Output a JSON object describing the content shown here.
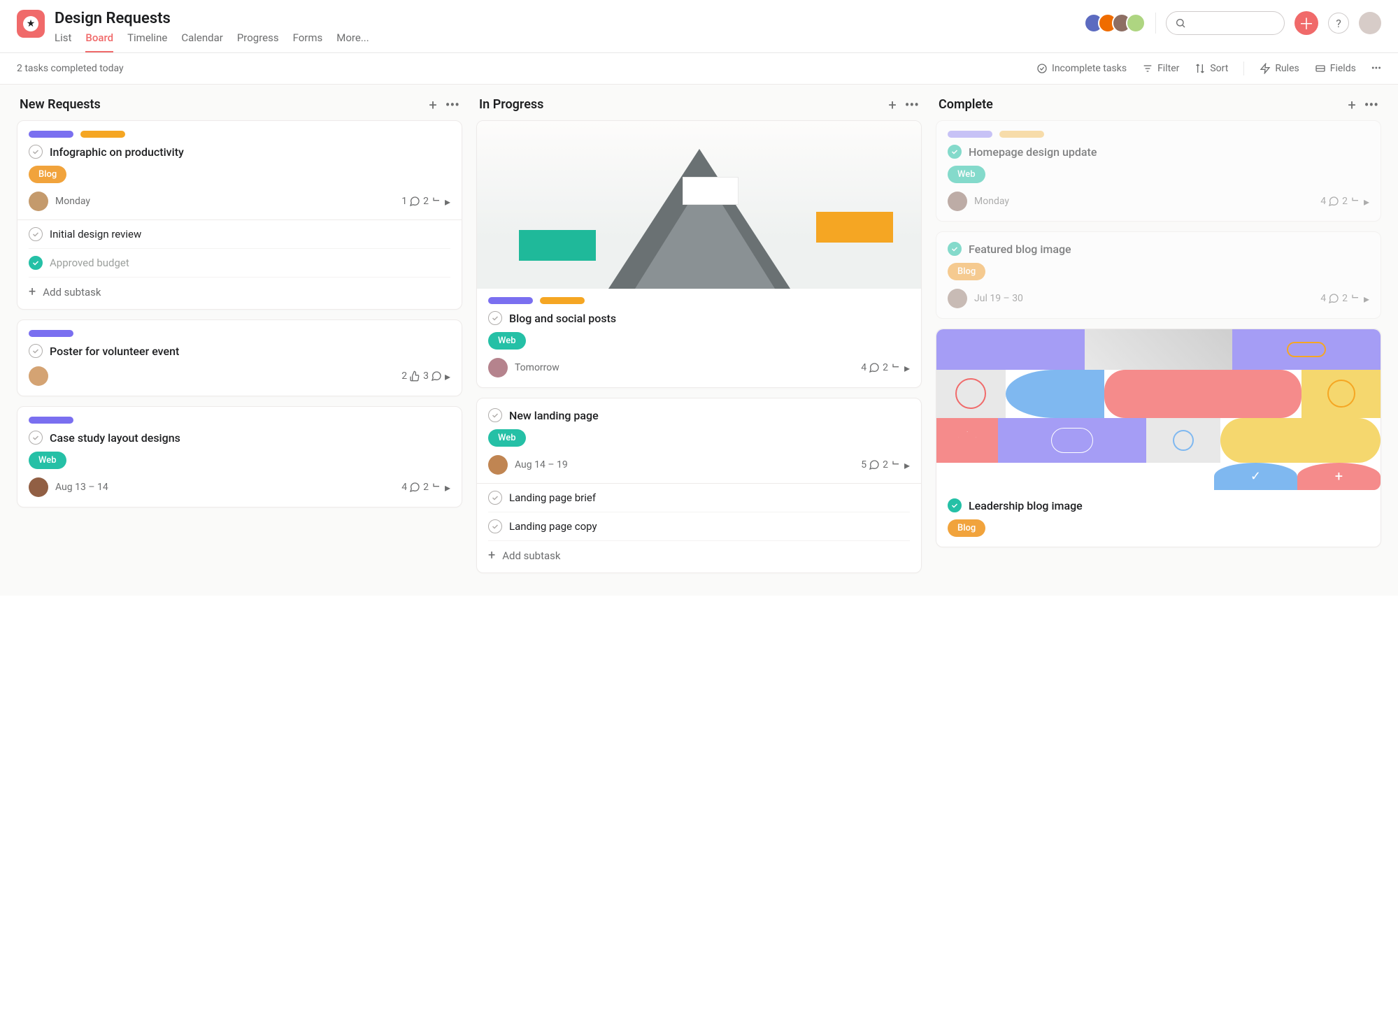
{
  "header": {
    "title": "Design Requests",
    "tabs": [
      "List",
      "Board",
      "Timeline",
      "Calendar",
      "Progress",
      "Forms",
      "More..."
    ],
    "active_tab": "Board",
    "search_placeholder": ""
  },
  "toolbar": {
    "status": "2 tasks completed today",
    "incomplete": "Incomplete tasks",
    "filter": "Filter",
    "sort": "Sort",
    "rules": "Rules",
    "fields": "Fields"
  },
  "columns": [
    {
      "title": "New Requests",
      "cards": [
        {
          "pills": [
            "#7a6ff0",
            "#f5a623"
          ],
          "title": "Infographic on productivity",
          "tag": {
            "label": "Blog",
            "type": "blog"
          },
          "assignee_color": "#c49a6c",
          "due": "Monday",
          "meta": {
            "comments": 1,
            "subtasks": 2
          },
          "subtasks": [
            {
              "title": "Initial design review",
              "done": false
            },
            {
              "title": "Approved budget",
              "done": true
            }
          ],
          "add_subtask": "Add subtask"
        },
        {
          "pills": [
            "#7a6ff0"
          ],
          "title": "Poster for volunteer event",
          "assignee_color": "#d4a373",
          "meta": {
            "likes": 2,
            "comments": 3
          }
        },
        {
          "pills": [
            "#7a6ff0"
          ],
          "title": "Case study layout designs",
          "tag": {
            "label": "Web",
            "type": "web"
          },
          "assignee_color": "#915f44",
          "due": "Aug 13 – 14",
          "meta": {
            "comments": 4,
            "subtasks": 2
          }
        }
      ]
    },
    {
      "title": "In Progress",
      "cards": [
        {
          "image": "mountain",
          "pills": [
            "#7a6ff0",
            "#f5a623"
          ],
          "title": "Blog and social posts",
          "tag": {
            "label": "Web",
            "type": "web"
          },
          "assignee_color": "#b5838d",
          "due": "Tomorrow",
          "meta": {
            "comments": 4,
            "subtasks": 2
          }
        },
        {
          "title": "New landing page",
          "tag": {
            "label": "Web",
            "type": "web"
          },
          "assignee_color": "#c08552",
          "due": "Aug 14 – 19",
          "meta": {
            "comments": 5,
            "subtasks": 2
          },
          "subtasks": [
            {
              "title": "Landing page brief",
              "done": false
            },
            {
              "title": "Landing page copy",
              "done": false
            }
          ],
          "add_subtask": "Add subtask"
        }
      ]
    },
    {
      "title": "Complete",
      "cards": [
        {
          "faded": true,
          "done": true,
          "pills": [
            "#9e95f5",
            "#f5c56b"
          ],
          "title": "Homepage design update",
          "tag": {
            "label": "Web",
            "type": "web"
          },
          "assignee_color": "#8d6e63",
          "due": "Monday",
          "meta": {
            "comments": 4,
            "subtasks": 2
          }
        },
        {
          "faded": true,
          "done": true,
          "title": "Featured blog image",
          "tag": {
            "label": "Blog",
            "type": "blog"
          },
          "assignee_color": "#a1887f",
          "due": "Jul 19 – 30",
          "meta": {
            "comments": 4,
            "subtasks": 2
          }
        },
        {
          "image": "geo",
          "done": true,
          "title": "Leadership blog image",
          "tag": {
            "label": "Blog",
            "type": "blog"
          }
        }
      ]
    }
  ],
  "avatar_colors": [
    "#5c6bc0",
    "#ef6c00",
    "#8d6e63",
    "#aed581"
  ],
  "user_color": "#d7ccc8"
}
